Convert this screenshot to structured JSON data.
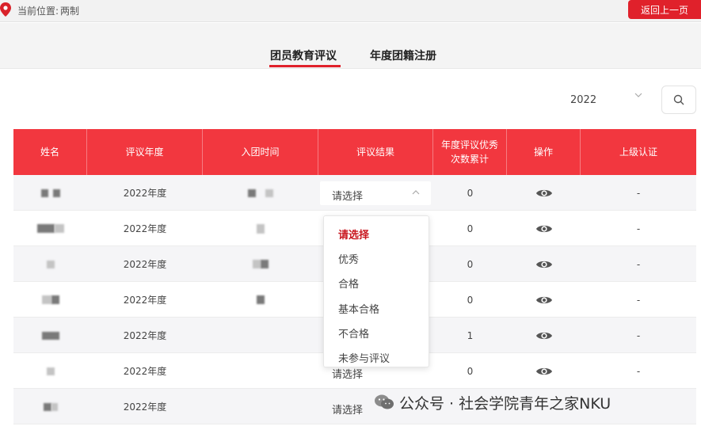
{
  "topbar": {
    "location_prefix": "当前位置:",
    "location_value": "两制",
    "back_label": "返回上一页",
    "icons": {
      "location": "location-pin-icon"
    }
  },
  "tabs": [
    {
      "label": "团员教育评议",
      "active": true
    },
    {
      "label": "年度团籍注册",
      "active": false
    }
  ],
  "filter": {
    "year_value": "2022",
    "icons": {
      "year_dropdown": "chevron-down-icon",
      "search": "search-icon"
    }
  },
  "table": {
    "headers": [
      "姓名",
      "评议年度",
      "入团时间",
      "评议结果",
      "年度评议优秀\n次数累计",
      "操作",
      "上级认证"
    ],
    "rows": [
      {
        "year": "2022年度",
        "result": "请选择",
        "excellent_count": "0",
        "certification": "-"
      },
      {
        "year": "2022年度",
        "result": "",
        "excellent_count": "0",
        "certification": "-"
      },
      {
        "year": "2022年度",
        "result": "",
        "excellent_count": "0",
        "certification": "-"
      },
      {
        "year": "2022年度",
        "result": "",
        "excellent_count": "0",
        "certification": "-"
      },
      {
        "year": "2022年度",
        "result": "",
        "excellent_count": "1",
        "certification": "-"
      },
      {
        "year": "2022年度",
        "result": "请选择",
        "excellent_count": "0",
        "certification": "-"
      },
      {
        "year": "2022年度",
        "result": "请选择",
        "excellent_count": "",
        "certification": ""
      }
    ],
    "icons": {
      "view": "eye-icon"
    }
  },
  "dropdown": {
    "options": [
      "请选择",
      "优秀",
      "合格",
      "基本合格",
      "不合格",
      "未参与评议"
    ],
    "selected": "请选择"
  },
  "watermark": {
    "text": "公众号 · 社会学院青年之家NKU",
    "icon": "wechat-icon"
  },
  "colors": {
    "accent_red": "#e0212b",
    "header_red": "#f2373f",
    "selected_option": "#c8161e"
  }
}
